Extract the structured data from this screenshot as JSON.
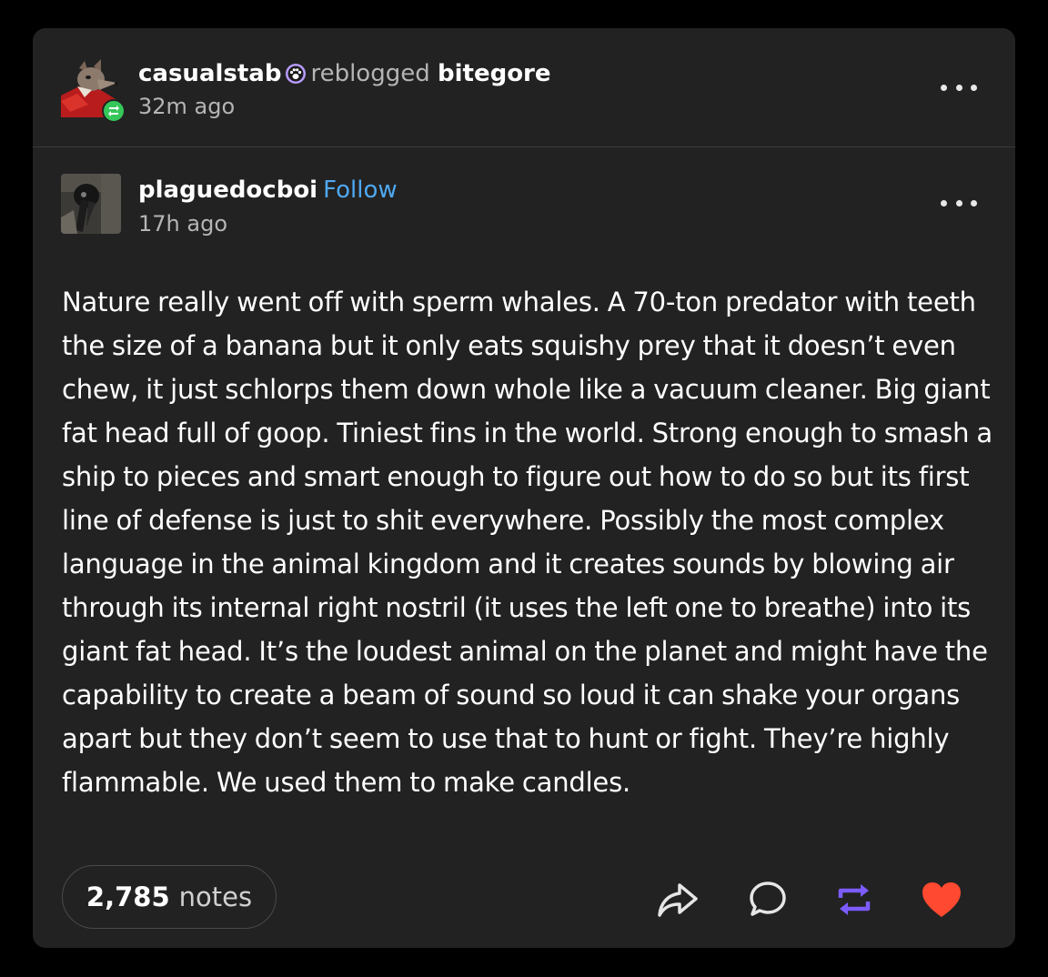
{
  "reblog": {
    "reblogger": "casualstab",
    "action": "reblogged",
    "source": "bitegore",
    "time": "32m ago"
  },
  "original": {
    "author": "plaguedocboi",
    "follow_label": "Follow",
    "time": "17h ago",
    "body": "Nature really went off with sperm whales. A 70-ton predator with teeth the size of a banana but it only eats squishy prey that it doesn’t even chew, it just schlorps them down whole like a vacuum cleaner. Big giant fat head full of goop. Tiniest fins in the world. Strong enough to smash a ship to pieces and smart enough to figure out how to do so but its first line of defense is just to shit everywhere. Possibly the most complex language in the animal kingdom and it creates sounds by blowing air through its internal right nostril (it uses the left one to breathe) into its giant fat head. It’s the loudest animal on the planet and might have the capability to create a beam of sound so loud it can shake your organs apart but they don’t seem to use that to hunt or fight. They’re highly flammable. We used them to make candles."
  },
  "footer": {
    "notes_count": "2,785",
    "notes_label": "notes"
  },
  "icons": {
    "more": "more-dots-icon",
    "share": "share-icon",
    "reply": "reply-icon",
    "reblog": "reblog-icon",
    "like": "heart-icon",
    "badge": "paw-badge-icon",
    "reblog_badge": "reblog-badge-icon"
  },
  "colors": {
    "background": "#000000",
    "card": "#222222",
    "follow": "#4fa8f0",
    "reblog_accent": "#7c5cff",
    "like": "#ff4930",
    "reblog_badge": "#35c75a"
  }
}
